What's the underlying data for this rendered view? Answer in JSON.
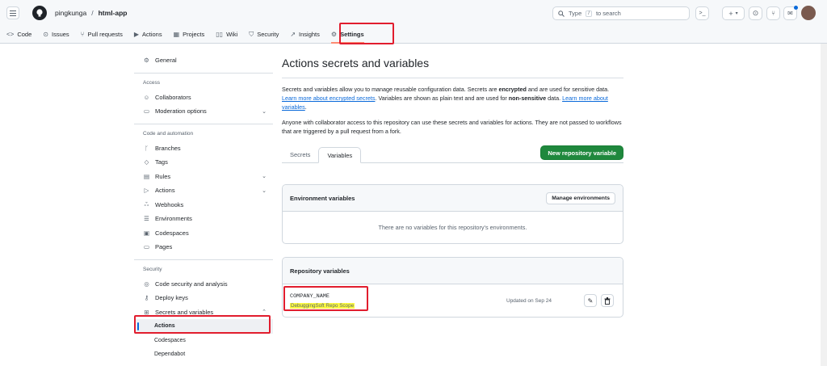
{
  "header": {
    "owner": "pingkunga",
    "separator": "/",
    "repo": "html-app",
    "search_prefix": "Type",
    "search_key": "/",
    "search_suffix": "to search"
  },
  "nav": [
    {
      "icon": "code-icon",
      "glyph": "<>",
      "label": "Code"
    },
    {
      "icon": "issues-icon",
      "glyph": "⊙",
      "label": "Issues"
    },
    {
      "icon": "pull-request-icon",
      "glyph": "⑂",
      "label": "Pull requests"
    },
    {
      "icon": "actions-icon",
      "glyph": "▶",
      "label": "Actions"
    },
    {
      "icon": "projects-icon",
      "glyph": "▦",
      "label": "Projects"
    },
    {
      "icon": "wiki-icon",
      "glyph": "▯▯",
      "label": "Wiki"
    },
    {
      "icon": "security-icon",
      "glyph": "⛉",
      "label": "Security"
    },
    {
      "icon": "insights-icon",
      "glyph": "↗",
      "label": "Insights"
    },
    {
      "icon": "settings-icon",
      "glyph": "⚙",
      "label": "Settings"
    }
  ],
  "sidebar": {
    "general": "General",
    "access_heading": "Access",
    "collaborators": "Collaborators",
    "moderation": "Moderation options",
    "code_heading": "Code and automation",
    "branches": "Branches",
    "tags": "Tags",
    "rules": "Rules",
    "actions": "Actions",
    "webhooks": "Webhooks",
    "environments": "Environments",
    "codespaces": "Codespaces",
    "pages": "Pages",
    "security_heading": "Security",
    "code_security": "Code security and analysis",
    "deploy_keys": "Deploy keys",
    "secrets_vars": "Secrets and variables",
    "sub_actions": "Actions",
    "sub_codespaces": "Codespaces",
    "sub_dependabot": "Dependabot"
  },
  "main": {
    "title": "Actions secrets and variables",
    "p1_a": "Secrets and variables allow you to manage reusable configuration data. Secrets are ",
    "p1_b": "encrypted",
    "p1_c": " and are used for sensitive data. ",
    "p1_link1": "Learn more about encrypted secrets",
    "p1_d": ". Variables are shown as plain text and are used for ",
    "p1_e": "non-sensitive",
    "p1_f": " data. ",
    "p1_link2": "Learn more about variables",
    "p1_g": ".",
    "p2": "Anyone with collaborator access to this repository can use these secrets and variables for actions. They are not passed to workflows that are triggered by a pull request from a fork.",
    "tab_secrets": "Secrets",
    "tab_variables": "Variables",
    "new_button": "New repository variable",
    "env_heading": "Environment variables",
    "manage_env": "Manage environments",
    "env_empty": "There are no variables for this repository's environments.",
    "repo_heading": "Repository variables",
    "var_name": "COMPANY_NAME",
    "var_value": "DebuggingSoft Repo Scope",
    "var_updated": "Updated on Sep 24"
  }
}
